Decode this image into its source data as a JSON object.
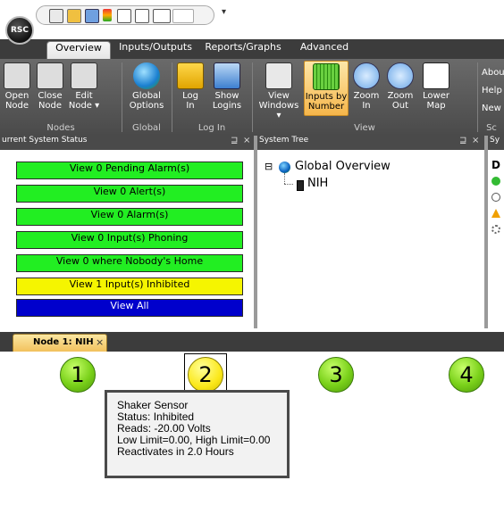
{
  "app": {
    "logo_text": "RSC",
    "qat_more": "▾"
  },
  "ribbon_tabs": [
    "Overview",
    "Inputs/Outputs",
    "Reports/Graphs",
    "Advanced"
  ],
  "ribbon_buttons": [
    {
      "label": "Open\nNode",
      "icon": "open-node-icon"
    },
    {
      "label": "Close\nNode",
      "icon": "close-node-icon"
    },
    {
      "label": "Edit\nNode ▾",
      "icon": "edit-node-icon"
    },
    {
      "label": "Global\nOptions",
      "icon": "globe-icon"
    },
    {
      "label": "Log\nIn",
      "icon": "lock-icon"
    },
    {
      "label": "Show\nLogins",
      "icon": "users-icon"
    },
    {
      "label": "View\nWindows ▾",
      "icon": "windows-icon"
    },
    {
      "label": "Inputs by\nNumber",
      "icon": "grid-icon"
    },
    {
      "label": "Zoom\nIn",
      "icon": "zoom-in-icon"
    },
    {
      "label": "Zoom\nOut",
      "icon": "zoom-out-icon"
    },
    {
      "label": "Lower\nMap",
      "icon": "map-icon"
    }
  ],
  "ribbon_groups": [
    "Nodes",
    "Global",
    "Log In",
    "View",
    "Sc"
  ],
  "ribbon_side_links": [
    "Abou",
    "Help",
    "New"
  ],
  "status_panel": {
    "title": "urrent System Status",
    "buttons": [
      {
        "label": "View 0 Pending Alarm(s)",
        "color": "#22ee22"
      },
      {
        "label": "View 0 Alert(s)",
        "color": "#22ee22"
      },
      {
        "label": "View 0 Alarm(s)",
        "color": "#22ee22"
      },
      {
        "label": "View 0 Input(s) Phoning",
        "color": "#22ee22"
      },
      {
        "label": "View 0 where Nobody's Home",
        "color": "#22ee22"
      },
      {
        "label": "View 1 Input(s) Inhibited",
        "color": "#f5f500"
      },
      {
        "label": "View All",
        "color": "#0000cc"
      }
    ]
  },
  "tree_panel": {
    "title": "System Tree",
    "root": "Global Overview",
    "child": "NIH",
    "expand": "⊟"
  },
  "right_panel": {
    "title": "Sy",
    "letter": "D"
  },
  "pin_glyph": "⊒",
  "close_glyph": "×",
  "doc_tab": {
    "label": "Node 1: NIH",
    "close": "×"
  },
  "nodes": [
    {
      "number": "1",
      "state": "green"
    },
    {
      "number": "2",
      "state": "yellow"
    },
    {
      "number": "3",
      "state": "green"
    },
    {
      "number": "4",
      "state": "green"
    }
  ],
  "tooltip": [
    "Shaker Sensor",
    "Status: Inhibited",
    "Reads: -20.00 Volts",
    "Low Limit=0.00, High Limit=0.00",
    "Reactivates in 2.0 Hours"
  ]
}
